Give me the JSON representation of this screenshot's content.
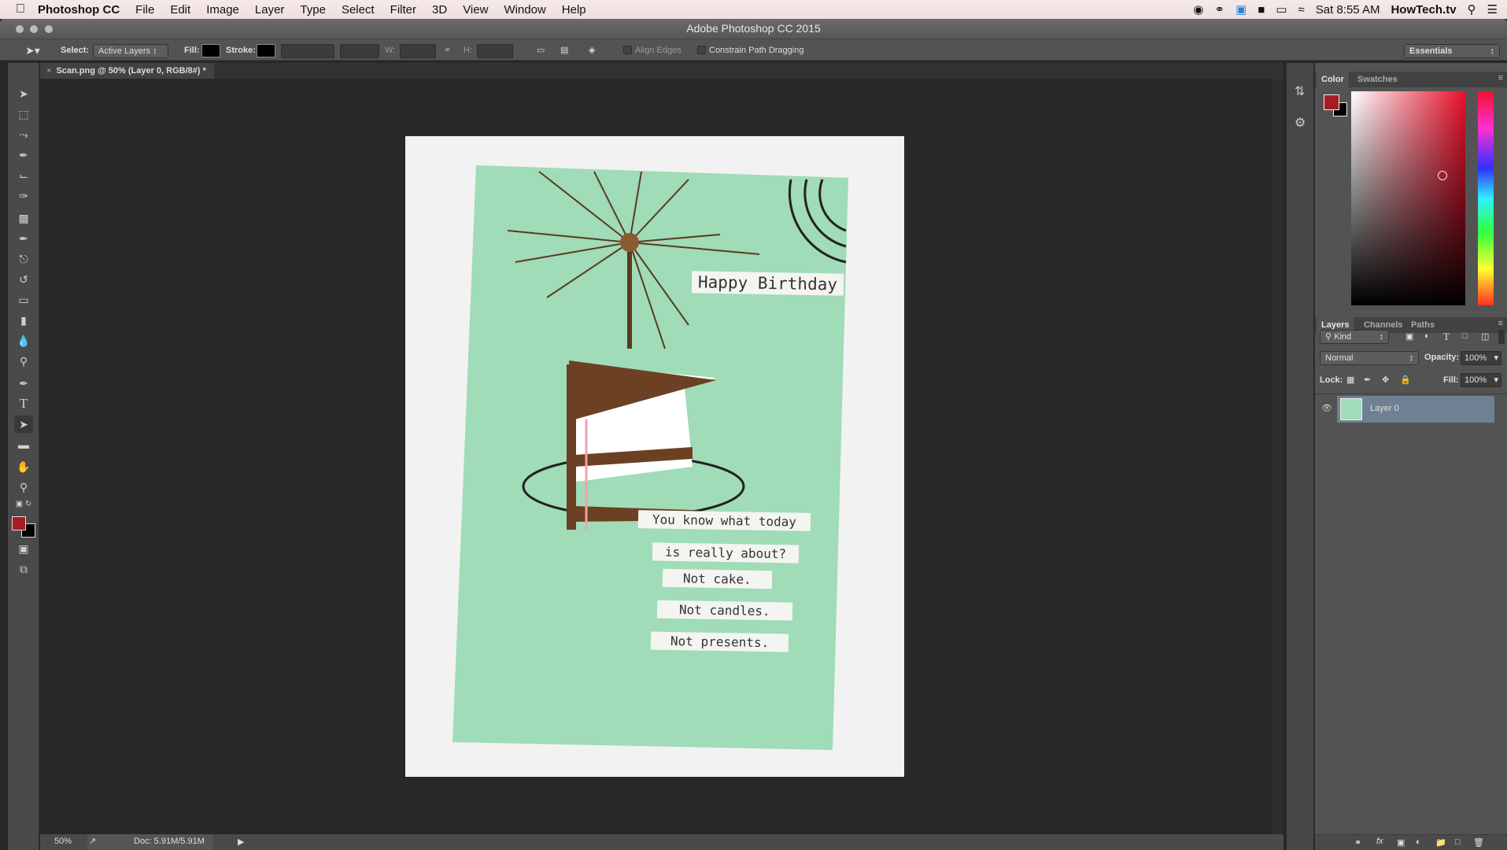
{
  "menubar": {
    "app_name": "Photoshop CC",
    "items": [
      "File",
      "Edit",
      "Image",
      "Layer",
      "Type",
      "Select",
      "Filter",
      "3D",
      "View",
      "Window",
      "Help"
    ],
    "clock": "Sat 8:55 AM",
    "user": "HowTech.tv"
  },
  "window": {
    "title": "Adobe Photoshop CC 2015"
  },
  "options": {
    "select_label": "Select:",
    "select_value": "Active Layers",
    "fill_label": "Fill:",
    "stroke_label": "Stroke:",
    "w_label": "W:",
    "h_label": "H:",
    "align_edges": "Align Edges",
    "constrain": "Constrain Path Dragging",
    "workspace": "Essentials"
  },
  "document": {
    "tab_title": "Scan.png @ 50% (Layer 0, RGB/8#) *",
    "card": {
      "headline": "Happy Birthday",
      "lines": [
        "You know what today",
        "is really about?",
        "Not cake.",
        "Not candles.",
        "Not presents."
      ]
    }
  },
  "status": {
    "zoom": "50%",
    "doc_size": "Doc: 5.91M/5.91M"
  },
  "colors": {
    "foreground": "#a81c24",
    "background": "#000000"
  },
  "color_panel": {
    "tabs": [
      "Color",
      "Swatches"
    ]
  },
  "layers_panel": {
    "tabs": [
      "Layers",
      "Channels",
      "Paths"
    ],
    "filter": "Kind",
    "blend_mode": "Normal",
    "opacity_label": "Opacity:",
    "opacity": "100%",
    "lock_label": "Lock:",
    "fill_label": "Fill:",
    "fill": "100%",
    "layers": [
      {
        "name": "Layer 0",
        "visible": true,
        "selected": true
      }
    ]
  }
}
